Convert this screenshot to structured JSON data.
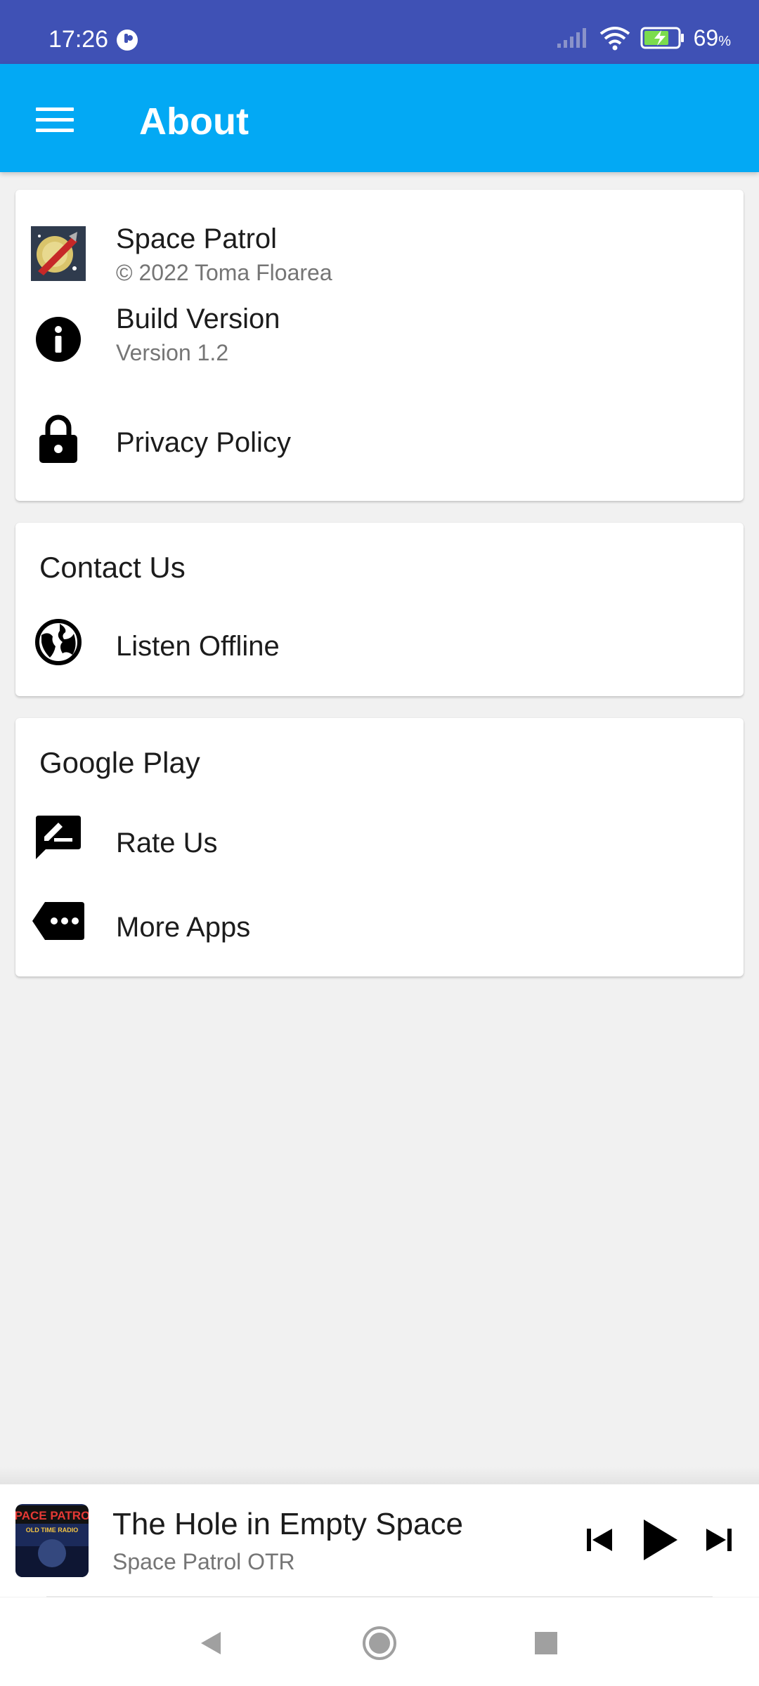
{
  "status_bar": {
    "time": "17:26",
    "battery_percent": "69",
    "battery_unit": "%"
  },
  "app_bar": {
    "title": "About",
    "menu_icon": "hamburger-menu-icon"
  },
  "about_card": {
    "app_name": "Space Patrol",
    "copyright": "© 2022 Toma Floarea",
    "build_label": "Build Version",
    "build_value": "Version 1.2",
    "privacy_label": "Privacy Policy",
    "icons": [
      "app-logo-icon",
      "info-icon",
      "lock-icon"
    ]
  },
  "contact_card": {
    "heading": "Contact Us",
    "item_label": "Listen Offline",
    "icon": "globe-icon"
  },
  "google_play_card": {
    "heading": "Google Play",
    "rate_label": "Rate Us",
    "more_label": "More Apps",
    "icons": [
      "rate-review-icon",
      "more-apps-icon"
    ]
  },
  "player": {
    "title": "The Hole in Empty Space",
    "subtitle": "Space Patrol OTR",
    "art_text_top": "SPACE PATROL",
    "art_text_bottom": "OLD TIME RADIO",
    "controls": [
      "skip-previous-icon",
      "play-icon",
      "skip-next-icon"
    ]
  },
  "colors": {
    "status_bar": "#3f51b5",
    "app_bar": "#03a9f4",
    "background": "#f1f1f1",
    "card": "#ffffff"
  }
}
